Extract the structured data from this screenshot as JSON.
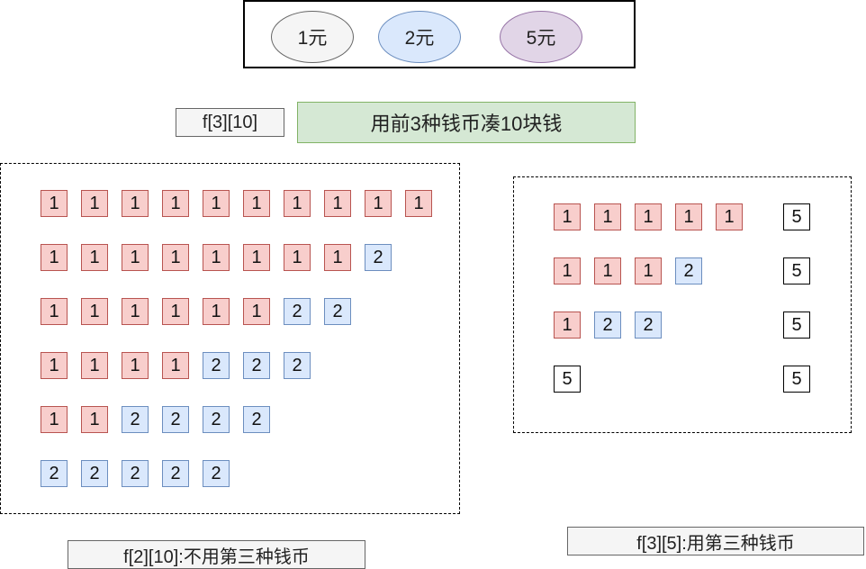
{
  "legend": {
    "coins": [
      {
        "label": "1元",
        "color": "#f5f5f5"
      },
      {
        "label": "2元",
        "color": "#dae8fc"
      },
      {
        "label": "5元",
        "color": "#e1d5e7"
      }
    ]
  },
  "state_label": "f[3][10]",
  "title": "用前3种钱币凑10块钱",
  "left_panel": {
    "caption": "f[2][10]:不用第三种钱币",
    "rows": [
      [
        "1",
        "1",
        "1",
        "1",
        "1",
        "1",
        "1",
        "1",
        "1",
        "1"
      ],
      [
        "1",
        "1",
        "1",
        "1",
        "1",
        "1",
        "1",
        "1",
        "2"
      ],
      [
        "1",
        "1",
        "1",
        "1",
        "1",
        "1",
        "2",
        "2"
      ],
      [
        "1",
        "1",
        "1",
        "1",
        "2",
        "2",
        "2"
      ],
      [
        "1",
        "1",
        "2",
        "2",
        "2",
        "2"
      ],
      [
        "2",
        "2",
        "2",
        "2",
        "2"
      ]
    ]
  },
  "right_panel": {
    "caption": "f[3][5]:用第三种钱币",
    "rows": [
      [
        "1",
        "1",
        "1",
        "1",
        "1"
      ],
      [
        "1",
        "1",
        "1",
        "2"
      ],
      [
        "1",
        "2",
        "2"
      ],
      [
        "5"
      ]
    ],
    "extra_coin": "5"
  },
  "colors": {
    "coin_1": "#f8cecc",
    "coin_2": "#dae8fc",
    "coin_5": "#ffffff",
    "title_bg": "#d5e8d4"
  }
}
